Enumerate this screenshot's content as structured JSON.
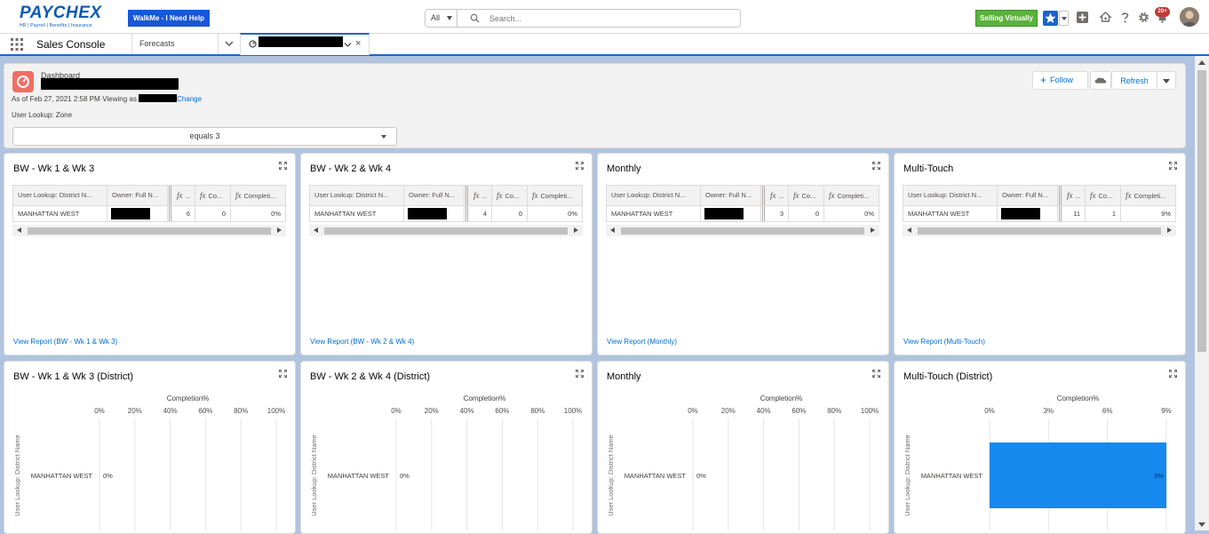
{
  "header": {
    "logo": {
      "name": "PAYCHEX",
      "tagline": "HR | Payroll | Benefits | Insurance"
    },
    "walkme_label": "WalkMe - I Need Help",
    "search": {
      "scope": "All",
      "placeholder": "Search..."
    },
    "selling_label": "Selling Virtually",
    "notification_count": "20+"
  },
  "nav": {
    "app_name": "Sales Console",
    "tabs": [
      {
        "label": "Forecasts"
      }
    ]
  },
  "dashboard": {
    "type_label": "Dashboard",
    "as_of": "As of Feb 27, 2021 2:58 PM·Viewing as ",
    "change_label": "Change",
    "filter_label": "User Lookup: Zone",
    "filter_value": "equals 3",
    "follow_label": "Follow",
    "refresh_label": "Refresh"
  },
  "table_columns": [
    "User Lookup: District N...",
    "Owner: Full N...",
    "...",
    "Co...",
    "Completi..."
  ],
  "table_widgets": [
    {
      "title": "BW - Wk 1 & Wk 3",
      "row": {
        "district": "MANHATTAN WEST",
        "f1": "6",
        "f2": "0",
        "pct": "0%"
      },
      "link": "View Report (BW - Wk 1 & Wk 3)"
    },
    {
      "title": "BW - Wk 2 & Wk 4",
      "row": {
        "district": "MANHATTAN WEST",
        "f1": "4",
        "f2": "0",
        "pct": "0%"
      },
      "link": "View Report (BW - Wk 2 & Wk 4)"
    },
    {
      "title": "Monthly",
      "row": {
        "district": "MANHATTAN WEST",
        "f1": "3",
        "f2": "0",
        "pct": "0%"
      },
      "link": "View Report (Monthly)"
    },
    {
      "title": "Multi-Touch",
      "row": {
        "district": "MANHATTAN WEST",
        "f1": "11",
        "f2": "1",
        "pct": "9%"
      },
      "link": "View Report (Multi-Touch)"
    }
  ],
  "chart_widgets": [
    {
      "title": "BW - Wk 1 & Wk 3 (District)"
    },
    {
      "title": "BW - Wk 2 & Wk 4 (District)"
    },
    {
      "title": "Monthly"
    },
    {
      "title": "Multi-Touch (District)"
    }
  ],
  "chart_data": [
    {
      "type": "bar",
      "orientation": "horizontal",
      "title": "BW - Wk 1 & Wk 3 (District)",
      "xlabel": "Completion%",
      "ylabel": "User Lookup: District Name",
      "categories": [
        "MANHATTAN WEST"
      ],
      "values": [
        0
      ],
      "value_labels": [
        "0%"
      ],
      "xticks": [
        "0%",
        "20%",
        "40%",
        "60%",
        "80%",
        "100%"
      ],
      "xlim": [
        0,
        100
      ],
      "bar_color": "#1589ee"
    },
    {
      "type": "bar",
      "orientation": "horizontal",
      "title": "BW - Wk 2 & Wk 4 (District)",
      "xlabel": "Completion%",
      "ylabel": "User Lookup: District Name",
      "categories": [
        "MANHATTAN WEST"
      ],
      "values": [
        0
      ],
      "value_labels": [
        "0%"
      ],
      "xticks": [
        "0%",
        "20%",
        "40%",
        "60%",
        "80%",
        "100%"
      ],
      "xlim": [
        0,
        100
      ],
      "bar_color": "#1589ee"
    },
    {
      "type": "bar",
      "orientation": "horizontal",
      "title": "Monthly",
      "xlabel": "Completion%",
      "ylabel": "User Lookup: District Name",
      "categories": [
        "MANHATTAN WEST"
      ],
      "values": [
        0
      ],
      "value_labels": [
        "0%"
      ],
      "xticks": [
        "0%",
        "20%",
        "40%",
        "60%",
        "80%",
        "100%"
      ],
      "xlim": [
        0,
        100
      ],
      "bar_color": "#1589ee"
    },
    {
      "type": "bar",
      "orientation": "horizontal",
      "title": "Multi-Touch (District)",
      "xlabel": "Completion%",
      "ylabel": "User Lookup: District Name",
      "categories": [
        "MANHATTAN WEST"
      ],
      "values": [
        9
      ],
      "value_labels": [
        "9%"
      ],
      "xticks": [
        "0%",
        "3%",
        "6%",
        "9%"
      ],
      "xlim": [
        0,
        9
      ],
      "bar_color": "#1589ee"
    }
  ],
  "colors": {
    "brand": "#0a5ab5",
    "walkme": "#1857d6",
    "selling": "#59b33b",
    "link": "#0070d2",
    "bar": "#1589ee",
    "dashboard_icon": "#ef6e64"
  },
  "icons": [
    "search-icon",
    "star-icon",
    "add-icon",
    "trailhead-icon",
    "help-icon",
    "gear-icon",
    "bell-icon",
    "waffle-icon",
    "dashboard-icon",
    "expand-icon"
  ]
}
